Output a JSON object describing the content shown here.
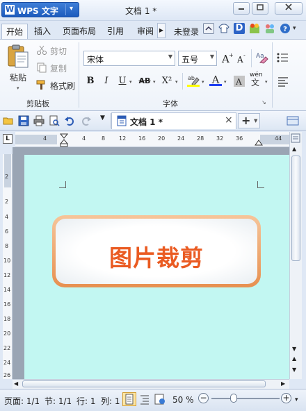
{
  "titlebar": {
    "app_name": "WPS 文字",
    "app_logo": "W",
    "doc_title": "文档 1 *",
    "minimize": "minimize-icon",
    "restore": "restore-icon",
    "close": "close-icon"
  },
  "tabs": [
    {
      "label": "开始",
      "active": true
    },
    {
      "label": "插入"
    },
    {
      "label": "页面布局"
    },
    {
      "label": "引用"
    },
    {
      "label": "审阅"
    }
  ],
  "account": {
    "login_label": "未登录"
  },
  "clipboard_group": {
    "label": "剪贴板",
    "paste_label": "粘贴",
    "cut_label": "剪切",
    "copy_label": "复制",
    "format_painter_label": "格式刷"
  },
  "font_group": {
    "label": "字体",
    "font_name": "宋体",
    "font_size": "五号",
    "bold": "B",
    "italic": "I",
    "underline": "U",
    "strike": "AB",
    "superscript": "X²",
    "font_color_glyph": "A",
    "phonetic_glyph": "wén"
  },
  "doc_tab": {
    "title": "文档 1 *",
    "close": "×",
    "new": "+"
  },
  "ruler": {
    "corner": "L",
    "h_ticks": [
      "4",
      "4",
      "8",
      "12",
      "16",
      "20",
      "24",
      "28",
      "32",
      "36",
      "44"
    ],
    "v_ticks": [
      "2",
      "2",
      "4",
      "6",
      "8",
      "10",
      "12",
      "14",
      "16",
      "18",
      "20",
      "22",
      "24",
      "26"
    ]
  },
  "document": {
    "badge_text": "图片裁剪",
    "page_color": "#c2f7f2",
    "text_color": "#ea5b22"
  },
  "statusbar": {
    "page": "页面: 1/1",
    "section": "节: 1/1",
    "row": "行: 1",
    "col": "列: 1",
    "zoom": "50 %",
    "zoom_level": 0.33
  }
}
